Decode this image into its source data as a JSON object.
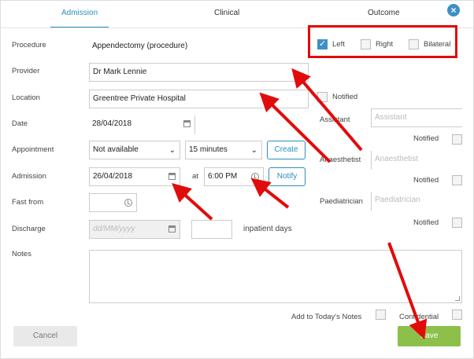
{
  "tabs": [
    {
      "label": "Admission"
    },
    {
      "label": "Clinical"
    },
    {
      "label": "Outcome"
    }
  ],
  "close_label": "×",
  "side": {
    "left": "Left",
    "right": "Right",
    "bilateral": "Bilateral",
    "left_checked": true
  },
  "form": {
    "procedure_label": "Procedure",
    "procedure_value": "Appendectomy (procedure)",
    "provider_label": "Provider",
    "provider_value": "Dr Mark Lennie",
    "location_label": "Location",
    "location_value": "Greentree Private Hospital",
    "location_notified": "Notified",
    "date_label": "Date",
    "date_value": "28/04/2018",
    "appointment_label": "Appointment",
    "appointment_value": "Not available",
    "duration_value": "15 minutes",
    "create_label": "Create",
    "admission_label": "Admission",
    "admission_date": "26/04/2018",
    "at_label": "at",
    "admission_time": "6:00 PM",
    "notify_label": "Notify",
    "fast_from_label": "Fast from",
    "discharge_label": "Discharge",
    "discharge_placeholder": "dd/MM/yyyy",
    "inpatient_days_label": "inpatient days",
    "notes_label": "Notes"
  },
  "staff": {
    "assistant_label": "Assistant",
    "assistant_placeholder": "Assistant",
    "anaesthetist_label": "Anaesthetist",
    "anaesthetist_placeholder": "Anaesthetist",
    "paediatrician_label": "Paediatrician",
    "paediatrician_placeholder": "Paediatrician",
    "notified": "Notified"
  },
  "footer": {
    "add_to_notes": "Add to Today's Notes",
    "confidential": "Confidential",
    "cancel": "Cancel",
    "save": "Save"
  },
  "colors": {
    "accent": "#2b8fbf",
    "save": "#8cc04b",
    "annotation": "#e20b0b"
  }
}
